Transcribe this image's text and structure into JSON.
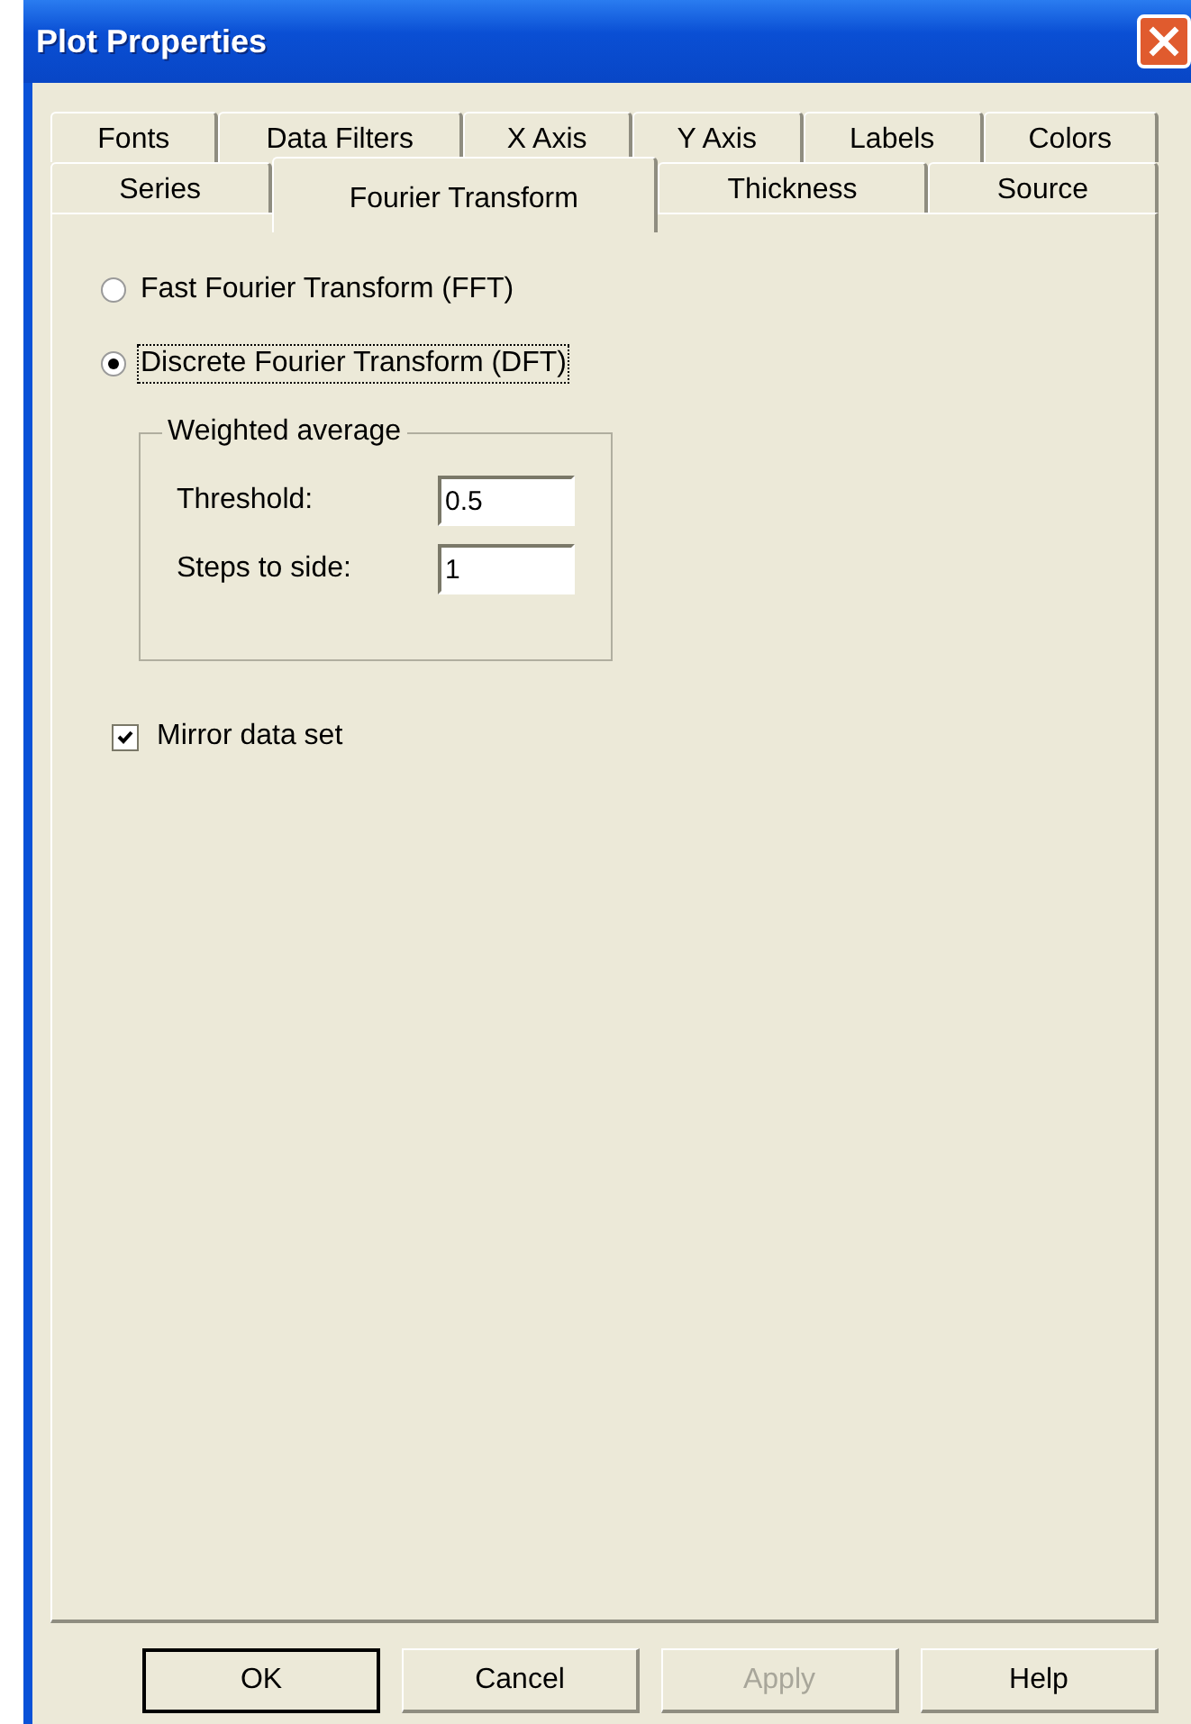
{
  "window": {
    "title": "Plot Properties"
  },
  "tab_rows": [
    [
      {
        "label": "Fonts",
        "selected": false
      },
      {
        "label": "Data Filters",
        "selected": false
      },
      {
        "label": "X Axis",
        "selected": false
      },
      {
        "label": "Y Axis",
        "selected": false
      },
      {
        "label": "Labels",
        "selected": false
      },
      {
        "label": "Colors",
        "selected": false
      }
    ],
    [
      {
        "label": "Series",
        "selected": false
      },
      {
        "label": "Fourier Transform",
        "selected": true
      },
      {
        "label": "Thickness",
        "selected": false
      },
      {
        "label": "Source",
        "selected": false
      }
    ]
  ],
  "radios": [
    {
      "label": "Fast Fourier Transform (FFT)",
      "selected": false,
      "focused": false
    },
    {
      "label": "Discrete Fourier Transform (DFT)",
      "selected": true,
      "focused": true
    }
  ],
  "group": {
    "title": "Weighted average",
    "fields": [
      {
        "label": "Threshold:",
        "value": "0.5"
      },
      {
        "label": "Steps to side:",
        "value": "1"
      }
    ]
  },
  "checkbox": {
    "label": "Mirror data set",
    "checked": true
  },
  "buttons": [
    {
      "label": "OK",
      "default": true,
      "disabled": false
    },
    {
      "label": "Cancel",
      "default": false,
      "disabled": false
    },
    {
      "label": "Apply",
      "default": false,
      "disabled": true
    },
    {
      "label": "Help",
      "default": false,
      "disabled": false
    }
  ]
}
